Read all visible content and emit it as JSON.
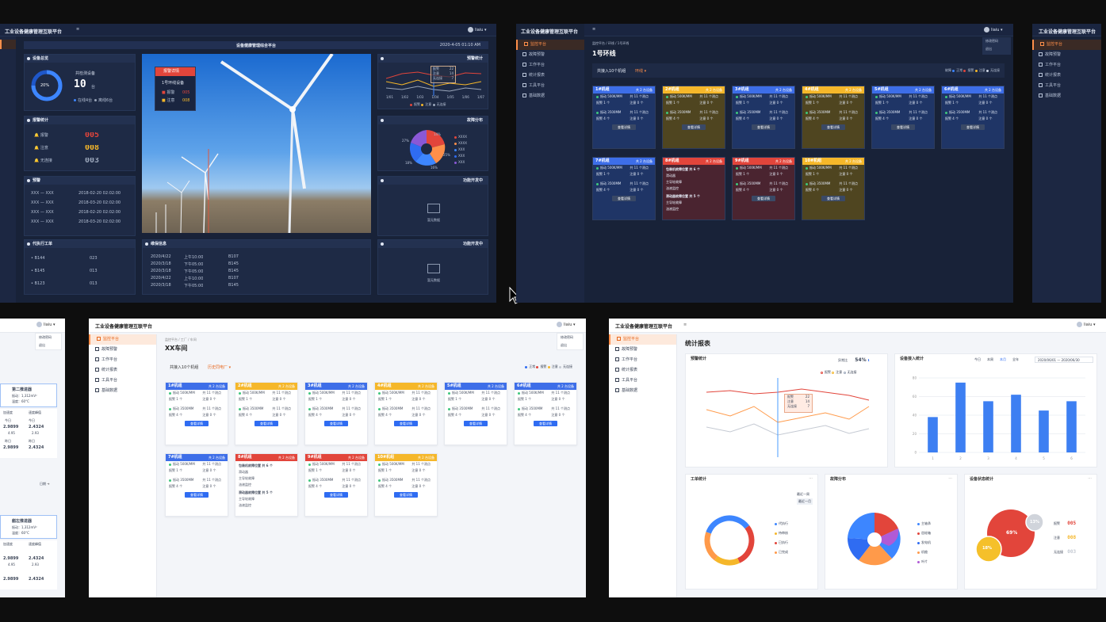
{
  "colors": {
    "accent": "#ff8f4a",
    "blue": "#2f6cf2",
    "red": "#e2453b",
    "yellow": "#f5b72a",
    "dark_bg": "#182238"
  },
  "common": {
    "app_title": "工业设备健康管理互联平台",
    "user": "liaiu"
  },
  "menu": [
    "监控平台",
    "故障预警",
    "工作平台",
    "统计报表",
    "工具平台",
    "基础数据"
  ],
  "user_menu": [
    "修改密码",
    "退出"
  ],
  "s1": {
    "header_center": "设备健康管理综合平台",
    "datetime": "2020-4-05   01:10 AM",
    "equip": {
      "title": "设备总览",
      "label": "共检测设备",
      "count": "10",
      "unit": "台",
      "pct": "20%",
      "legend_online": "在线4台",
      "legend_offline": "离线6台"
    },
    "alarm": {
      "title": "报警统计",
      "rows": [
        {
          "label": "报警",
          "value": "005"
        },
        {
          "label": "注意",
          "value": "008"
        },
        {
          "label": "无连接",
          "value": "003"
        }
      ]
    },
    "warn": {
      "title": "预警",
      "rows": [
        {
          "a": "XXX — XXX",
          "b": "2018-02-20 02:02:00"
        },
        {
          "a": "XXX — XXX",
          "b": "2018-03-20 02:02:00"
        },
        {
          "a": "XXX — XXX",
          "b": "2018-02-20 02:02:00"
        },
        {
          "a": "XXX — XXX",
          "b": "2018-03-20 02:02:00"
        }
      ]
    },
    "orders": {
      "title": "代执行工单",
      "rows": [
        {
          "a": "B144",
          "b": "023"
        },
        {
          "a": "B145",
          "b": "013"
        },
        {
          "a": "B123",
          "b": "013"
        }
      ]
    },
    "repair": {
      "title": "维保信息",
      "rows": [
        {
          "d": "2020/4/22",
          "t": "上午10:00",
          "c": "B107"
        },
        {
          "d": "2020/3/18",
          "t": "下午05:00",
          "c": "B145"
        },
        {
          "d": "2020/3/18",
          "t": "下午05:00",
          "c": "B145"
        },
        {
          "d": "2020/4/22",
          "t": "上午10:00",
          "c": "B107"
        },
        {
          "d": "2020/3/18",
          "t": "下午05:00",
          "c": "B145"
        }
      ]
    },
    "popup": {
      "title": "报警详情",
      "subtitle": "1号环线设备",
      "rows": [
        {
          "label": "报警",
          "value": "005"
        },
        {
          "label": "注意",
          "value": "008"
        }
      ]
    },
    "right": {
      "stats_title": "预警统计",
      "fault_title": "故障分布",
      "dev1_title": "功能开发中",
      "dev2_title": "功能开发中",
      "dev_note": "暂无数据",
      "legend": [
        "报警",
        "注意",
        "无连接"
      ],
      "tooltip": [
        "报警",
        "注意",
        "无连接"
      ],
      "tooltip_vals": [
        "22",
        "14",
        "7"
      ],
      "xaxis": [
        "1/01",
        "1/02",
        "1/03",
        "1/04",
        "1/05",
        "1/06",
        "1/07"
      ],
      "pie_labels": [
        "27%",
        "18%",
        "14%",
        "25%",
        "16%"
      ],
      "pie_legend": [
        "XXXX",
        "XXXX",
        "XXX",
        "XXX",
        "XXX"
      ]
    }
  },
  "s2": {
    "breadcrumb": "监控平台 / 环线 / 1号环线",
    "title": "1号环线",
    "bar_label": "共接入10个机组",
    "bar_select": "环线",
    "legend": [
      "故障",
      "正常",
      "报警",
      "注意",
      "无连接"
    ],
    "card_common": {
      "line1": "振动 500K/MM",
      "line1r": "共 11 个测点",
      "l2": "报警 1 个",
      "l2r": "注意 0 个",
      "line3": "振动 3500MM",
      "line3r": "共 11 个测点",
      "l4": "报警 4 个",
      "l4r": "注意 0 个",
      "btn": "查看详情"
    },
    "cards": [
      {
        "name": "1#机组",
        "right": "共 2 台设备"
      },
      {
        "name": "2#机组",
        "right": "共 2 台设备"
      },
      {
        "name": "3#机组",
        "right": "共 2 台设备"
      },
      {
        "name": "4#机组",
        "right": "共 2 台设备"
      },
      {
        "name": "5#机组",
        "right": "共 2 台设备"
      },
      {
        "name": "6#机组",
        "right": "共 2 台设备"
      },
      {
        "name": "7#机组",
        "right": "共 2 台设备"
      },
      {
        "name": "8#机组",
        "right": "共 2 台设备"
      },
      {
        "name": "9#机组",
        "right": "共 2 台设备"
      },
      {
        "name": "10#机组",
        "right": "共 2 台设备"
      }
    ],
    "fault": {
      "h1": "包装机故障位置  共 6 个",
      "a": "滑动器",
      "b": "主导轮故障",
      "c": "油液监控",
      "h2": "滑动器故障位置  共 5 个",
      "d": "主导轮故障",
      "e": "油液监控"
    }
  },
  "s3": {
    "breadcrumb": "监控平台 / 工厂 / 车间",
    "title": "XX车间",
    "bar_label": "共接入10个机组",
    "bar_select": "历史同电厂",
    "legend": [
      "正常",
      "报警",
      "注意",
      "无连接"
    ]
  },
  "s4": {
    "title": "统计报表",
    "warn_title": "预警统计",
    "rate_label": "异常比",
    "rate": "54%",
    "warn_legend": [
      "报警",
      "注意",
      "无连接"
    ],
    "access_title": "设备接入统计",
    "tabs": [
      "今日",
      "本周",
      "本月",
      "全年"
    ],
    "daterange": "2020/06/01 — 2020/06/30",
    "work_title": "工单统计",
    "work_tags": [
      "最近一周",
      "最近一月"
    ],
    "work_legend": [
      "代执行",
      "待审核",
      "已执行",
      "已完成"
    ],
    "fault_title": "故障分布",
    "fault_legend": [
      "主轴承",
      "齿轮箱",
      "发电机",
      "机舱",
      "叶片"
    ],
    "status_title": "设备状态统计",
    "status_labels": [
      "报警",
      "注意",
      "无连接"
    ],
    "status_vals": [
      "005",
      "008",
      "003"
    ],
    "status_pcts": [
      "69%",
      "13%",
      "18%"
    ],
    "tooltip": [
      "报警",
      "注意",
      "无连接"
    ],
    "tooltip_vals": [
      "22",
      "14",
      "7"
    ]
  },
  "s5": {
    "card1": {
      "title": "第二推进器",
      "l1": "振动：1,312mV²",
      "l2": "温度：60°C"
    },
    "card2": {
      "title": "艏左推进器",
      "l1": "振动：1,312mV²",
      "l2": "温度：60°C"
    },
    "labels": [
      "加速度",
      "速度峰值"
    ],
    "vals": [
      "2.9899",
      "2.4324",
      "4.95",
      "2.93"
    ],
    "units": [
      "今日",
      "昨日"
    ],
    "arrow": "日期"
  },
  "chart_data": {
    "type": "bar",
    "categories": [
      "1",
      "2",
      "3",
      "4",
      "5",
      "6"
    ],
    "values": [
      38,
      75,
      55,
      62,
      45,
      55
    ],
    "ylim": [
      0,
      80
    ]
  }
}
